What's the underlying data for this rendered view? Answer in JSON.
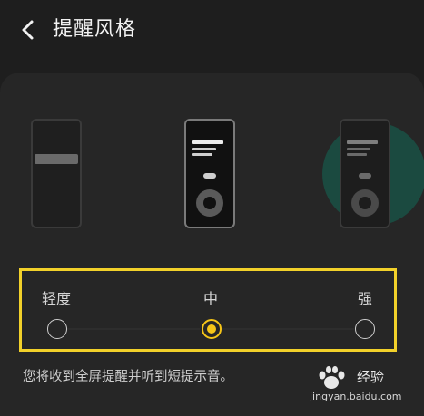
{
  "header": {
    "title": "提醒风格",
    "back_icon": "chevron-left-icon"
  },
  "options": [
    {
      "label": "轻度",
      "selected": false
    },
    {
      "label": "中",
      "selected": true
    },
    {
      "label": "强",
      "selected": false
    }
  ],
  "description": "您将收到全屏提醒并听到短提示音。",
  "watermark": {
    "text": "经验",
    "url": "jingyan.baidu.com"
  },
  "colors": {
    "accent": "#f5c518",
    "highlight_box": "#f2d12a",
    "background": "#1e1e1e",
    "card": "#262626",
    "glow": "#1b4a40"
  }
}
